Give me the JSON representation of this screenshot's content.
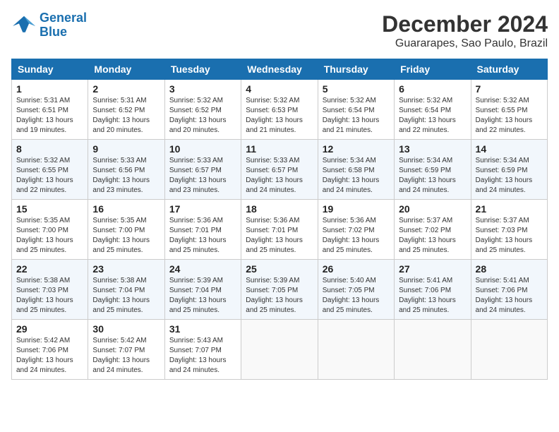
{
  "logo": {
    "line1": "General",
    "line2": "Blue"
  },
  "title": "December 2024",
  "location": "Guararapes, Sao Paulo, Brazil",
  "weekdays": [
    "Sunday",
    "Monday",
    "Tuesday",
    "Wednesday",
    "Thursday",
    "Friday",
    "Saturday"
  ],
  "weeks": [
    [
      {
        "day": "1",
        "info": "Sunrise: 5:31 AM\nSunset: 6:51 PM\nDaylight: 13 hours\nand 19 minutes."
      },
      {
        "day": "2",
        "info": "Sunrise: 5:31 AM\nSunset: 6:52 PM\nDaylight: 13 hours\nand 20 minutes."
      },
      {
        "day": "3",
        "info": "Sunrise: 5:32 AM\nSunset: 6:52 PM\nDaylight: 13 hours\nand 20 minutes."
      },
      {
        "day": "4",
        "info": "Sunrise: 5:32 AM\nSunset: 6:53 PM\nDaylight: 13 hours\nand 21 minutes."
      },
      {
        "day": "5",
        "info": "Sunrise: 5:32 AM\nSunset: 6:54 PM\nDaylight: 13 hours\nand 21 minutes."
      },
      {
        "day": "6",
        "info": "Sunrise: 5:32 AM\nSunset: 6:54 PM\nDaylight: 13 hours\nand 22 minutes."
      },
      {
        "day": "7",
        "info": "Sunrise: 5:32 AM\nSunset: 6:55 PM\nDaylight: 13 hours\nand 22 minutes."
      }
    ],
    [
      {
        "day": "8",
        "info": "Sunrise: 5:32 AM\nSunset: 6:55 PM\nDaylight: 13 hours\nand 22 minutes."
      },
      {
        "day": "9",
        "info": "Sunrise: 5:33 AM\nSunset: 6:56 PM\nDaylight: 13 hours\nand 23 minutes."
      },
      {
        "day": "10",
        "info": "Sunrise: 5:33 AM\nSunset: 6:57 PM\nDaylight: 13 hours\nand 23 minutes."
      },
      {
        "day": "11",
        "info": "Sunrise: 5:33 AM\nSunset: 6:57 PM\nDaylight: 13 hours\nand 24 minutes."
      },
      {
        "day": "12",
        "info": "Sunrise: 5:34 AM\nSunset: 6:58 PM\nDaylight: 13 hours\nand 24 minutes."
      },
      {
        "day": "13",
        "info": "Sunrise: 5:34 AM\nSunset: 6:59 PM\nDaylight: 13 hours\nand 24 minutes."
      },
      {
        "day": "14",
        "info": "Sunrise: 5:34 AM\nSunset: 6:59 PM\nDaylight: 13 hours\nand 24 minutes."
      }
    ],
    [
      {
        "day": "15",
        "info": "Sunrise: 5:35 AM\nSunset: 7:00 PM\nDaylight: 13 hours\nand 25 minutes."
      },
      {
        "day": "16",
        "info": "Sunrise: 5:35 AM\nSunset: 7:00 PM\nDaylight: 13 hours\nand 25 minutes."
      },
      {
        "day": "17",
        "info": "Sunrise: 5:36 AM\nSunset: 7:01 PM\nDaylight: 13 hours\nand 25 minutes."
      },
      {
        "day": "18",
        "info": "Sunrise: 5:36 AM\nSunset: 7:01 PM\nDaylight: 13 hours\nand 25 minutes."
      },
      {
        "day": "19",
        "info": "Sunrise: 5:36 AM\nSunset: 7:02 PM\nDaylight: 13 hours\nand 25 minutes."
      },
      {
        "day": "20",
        "info": "Sunrise: 5:37 AM\nSunset: 7:02 PM\nDaylight: 13 hours\nand 25 minutes."
      },
      {
        "day": "21",
        "info": "Sunrise: 5:37 AM\nSunset: 7:03 PM\nDaylight: 13 hours\nand 25 minutes."
      }
    ],
    [
      {
        "day": "22",
        "info": "Sunrise: 5:38 AM\nSunset: 7:03 PM\nDaylight: 13 hours\nand 25 minutes."
      },
      {
        "day": "23",
        "info": "Sunrise: 5:38 AM\nSunset: 7:04 PM\nDaylight: 13 hours\nand 25 minutes."
      },
      {
        "day": "24",
        "info": "Sunrise: 5:39 AM\nSunset: 7:04 PM\nDaylight: 13 hours\nand 25 minutes."
      },
      {
        "day": "25",
        "info": "Sunrise: 5:39 AM\nSunset: 7:05 PM\nDaylight: 13 hours\nand 25 minutes."
      },
      {
        "day": "26",
        "info": "Sunrise: 5:40 AM\nSunset: 7:05 PM\nDaylight: 13 hours\nand 25 minutes."
      },
      {
        "day": "27",
        "info": "Sunrise: 5:41 AM\nSunset: 7:06 PM\nDaylight: 13 hours\nand 25 minutes."
      },
      {
        "day": "28",
        "info": "Sunrise: 5:41 AM\nSunset: 7:06 PM\nDaylight: 13 hours\nand 24 minutes."
      }
    ],
    [
      {
        "day": "29",
        "info": "Sunrise: 5:42 AM\nSunset: 7:06 PM\nDaylight: 13 hours\nand 24 minutes."
      },
      {
        "day": "30",
        "info": "Sunrise: 5:42 AM\nSunset: 7:07 PM\nDaylight: 13 hours\nand 24 minutes."
      },
      {
        "day": "31",
        "info": "Sunrise: 5:43 AM\nSunset: 7:07 PM\nDaylight: 13 hours\nand 24 minutes."
      },
      null,
      null,
      null,
      null
    ]
  ]
}
